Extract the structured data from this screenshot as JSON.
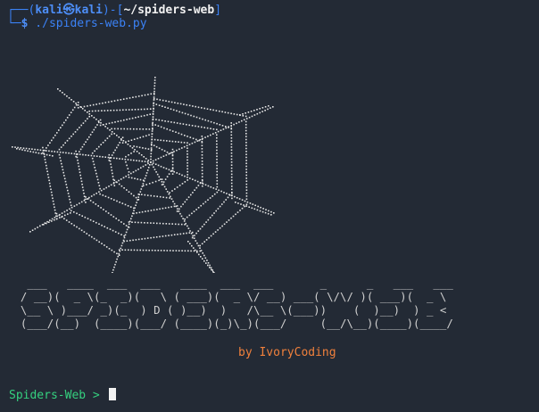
{
  "prompt": {
    "corner_top": "┌──(",
    "user": "kali",
    "at_symbol": "㉿",
    "host": "kali",
    "mid": ")-[",
    "path": "~/spiders-web",
    "end": "]",
    "corner_bottom": "└─",
    "dollar": "$",
    "command": " ./spiders-web.py"
  },
  "banner_art": [
    "   ___   ____  ___  ___   ____  ___  ___       _      _   ___   ___   ",
    "  / __)(  _ \\(_  _)(   \\ ( ___)(  _ \\/ __) ___( \\/\\/ )( ___)(  _ \\  ",
    "  \\__ \\ )___/ _)(_  ) D ( )__)  )   /\\__ \\(___))    (  )__)  ) _ <  ",
    "  (___/(__)  (____)(___/ (____)(_)\\_)(___/     (__/\\__)(____)(____/  "
  ],
  "byline": "by IvoryCoding",
  "input_prompt": "Spiders-Web > ",
  "colors": {
    "background": "#232a35",
    "prompt_blue": "#3b82f6",
    "byline_orange": "#f0803c",
    "input_green": "#35d07f"
  }
}
